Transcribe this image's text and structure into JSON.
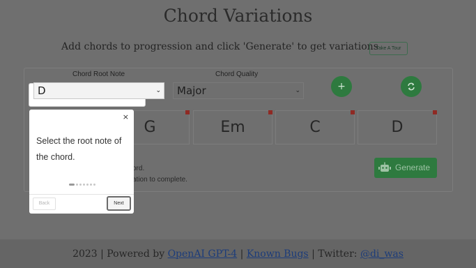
{
  "header": {
    "title": "Chord Variations",
    "subtitle": "Add chords to progression and click 'Generate' to get variations",
    "tour_label": "Take A Tour"
  },
  "form": {
    "root_label": "Chord Root Note",
    "root_value": "D",
    "quality_label": "Chord Quality",
    "quality_value": "Major"
  },
  "progression": {
    "chords": [
      "G",
      "Em",
      "C",
      "D"
    ]
  },
  "actions": {
    "add_icon": "plus-icon",
    "refresh_icon": "refresh-icon",
    "generate_label": "Generate",
    "generate_icon": "robot-icon"
  },
  "hints": {
    "line1": "ord.",
    "line2": "ation to complete."
  },
  "tour_popover": {
    "message": "Select the root note of the chord.",
    "close_glyph": "×",
    "back_label": "Back",
    "next_label": "Next",
    "step_active": 1,
    "step_total": 7
  },
  "footer": {
    "year_text": "2023 | Powered by ",
    "powered_link": "OpenAI GPT-4",
    "sep1": " | ",
    "bugs_link": "Known Bugs",
    "twitter_prefix": " | Twitter: ",
    "twitter_link": "@di_was"
  },
  "colors": {
    "accent_green": "#2e7a3f",
    "remove_red": "#8f2a24",
    "overlay_bg": "#6f6f6f"
  }
}
